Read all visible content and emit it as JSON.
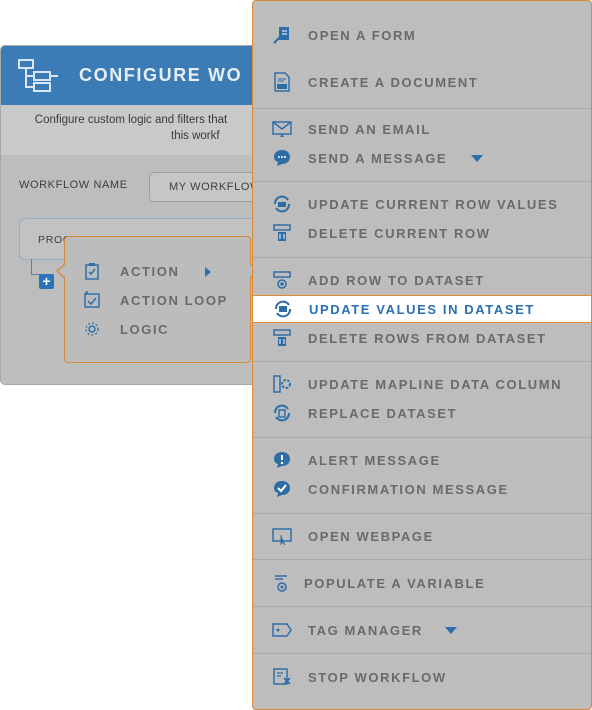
{
  "dialog": {
    "title": "CONFIGURE WO",
    "description_line1": "Configure custom logic and filters that",
    "description_line2": "this workf",
    "workflow_name_label": "WORKFLOW NAME",
    "workflow_name_value": "MY WORKFLOW",
    "process_text": "PROCESS THE FOLLOWING",
    "add_symbol": "+"
  },
  "submenu": {
    "items": [
      {
        "label": "ACTION",
        "icon": "clipboard-check-icon"
      },
      {
        "label": "ACTION LOOP",
        "icon": "loop-check-icon"
      },
      {
        "label": "LOGIC",
        "icon": "logic-gear-icon"
      }
    ]
  },
  "menu": {
    "items": [
      {
        "label": "OPEN A FORM",
        "icon": "form-edit-icon"
      },
      {
        "label": "CREATE A DOCUMENT",
        "icon": "pdf-document-icon"
      },
      {
        "label": "SEND AN EMAIL",
        "icon": "email-icon"
      },
      {
        "label": "SEND A MESSAGE",
        "icon": "chat-bubble-icon"
      },
      {
        "label": "UPDATE CURRENT ROW VALUES",
        "icon": "refresh-row-icon"
      },
      {
        "label": "DELETE CURRENT ROW",
        "icon": "delete-row-icon"
      },
      {
        "label": "ADD ROW TO DATASET",
        "icon": "add-row-icon"
      },
      {
        "label": "UPDATE VALUES IN DATASET",
        "icon": "refresh-dataset-icon"
      },
      {
        "label": "DELETE ROWS FROM DATASET",
        "icon": "delete-rows-icon"
      },
      {
        "label": "UPDATE MAPLINE DATA COLUMN",
        "icon": "data-column-gear-icon"
      },
      {
        "label": "REPLACE DATASET",
        "icon": "replace-dataset-icon"
      },
      {
        "label": "ALERT MESSAGE",
        "icon": "alert-bubble-icon"
      },
      {
        "label": "CONFIRMATION MESSAGE",
        "icon": "confirm-bubble-icon"
      },
      {
        "label": "OPEN WEBPAGE",
        "icon": "webpage-icon"
      },
      {
        "label": "POPULATE A VARIABLE",
        "icon": "variable-icon"
      },
      {
        "label": "TAG MANAGER",
        "icon": "tag-icon"
      },
      {
        "label": "STOP WORKFLOW",
        "icon": "stop-workflow-icon"
      }
    ],
    "highlighted_index": 7
  },
  "colors": {
    "accent_blue": "#2a6fb0",
    "highlight_border": "#e28a33",
    "header_blue": "#3b7cb6"
  }
}
